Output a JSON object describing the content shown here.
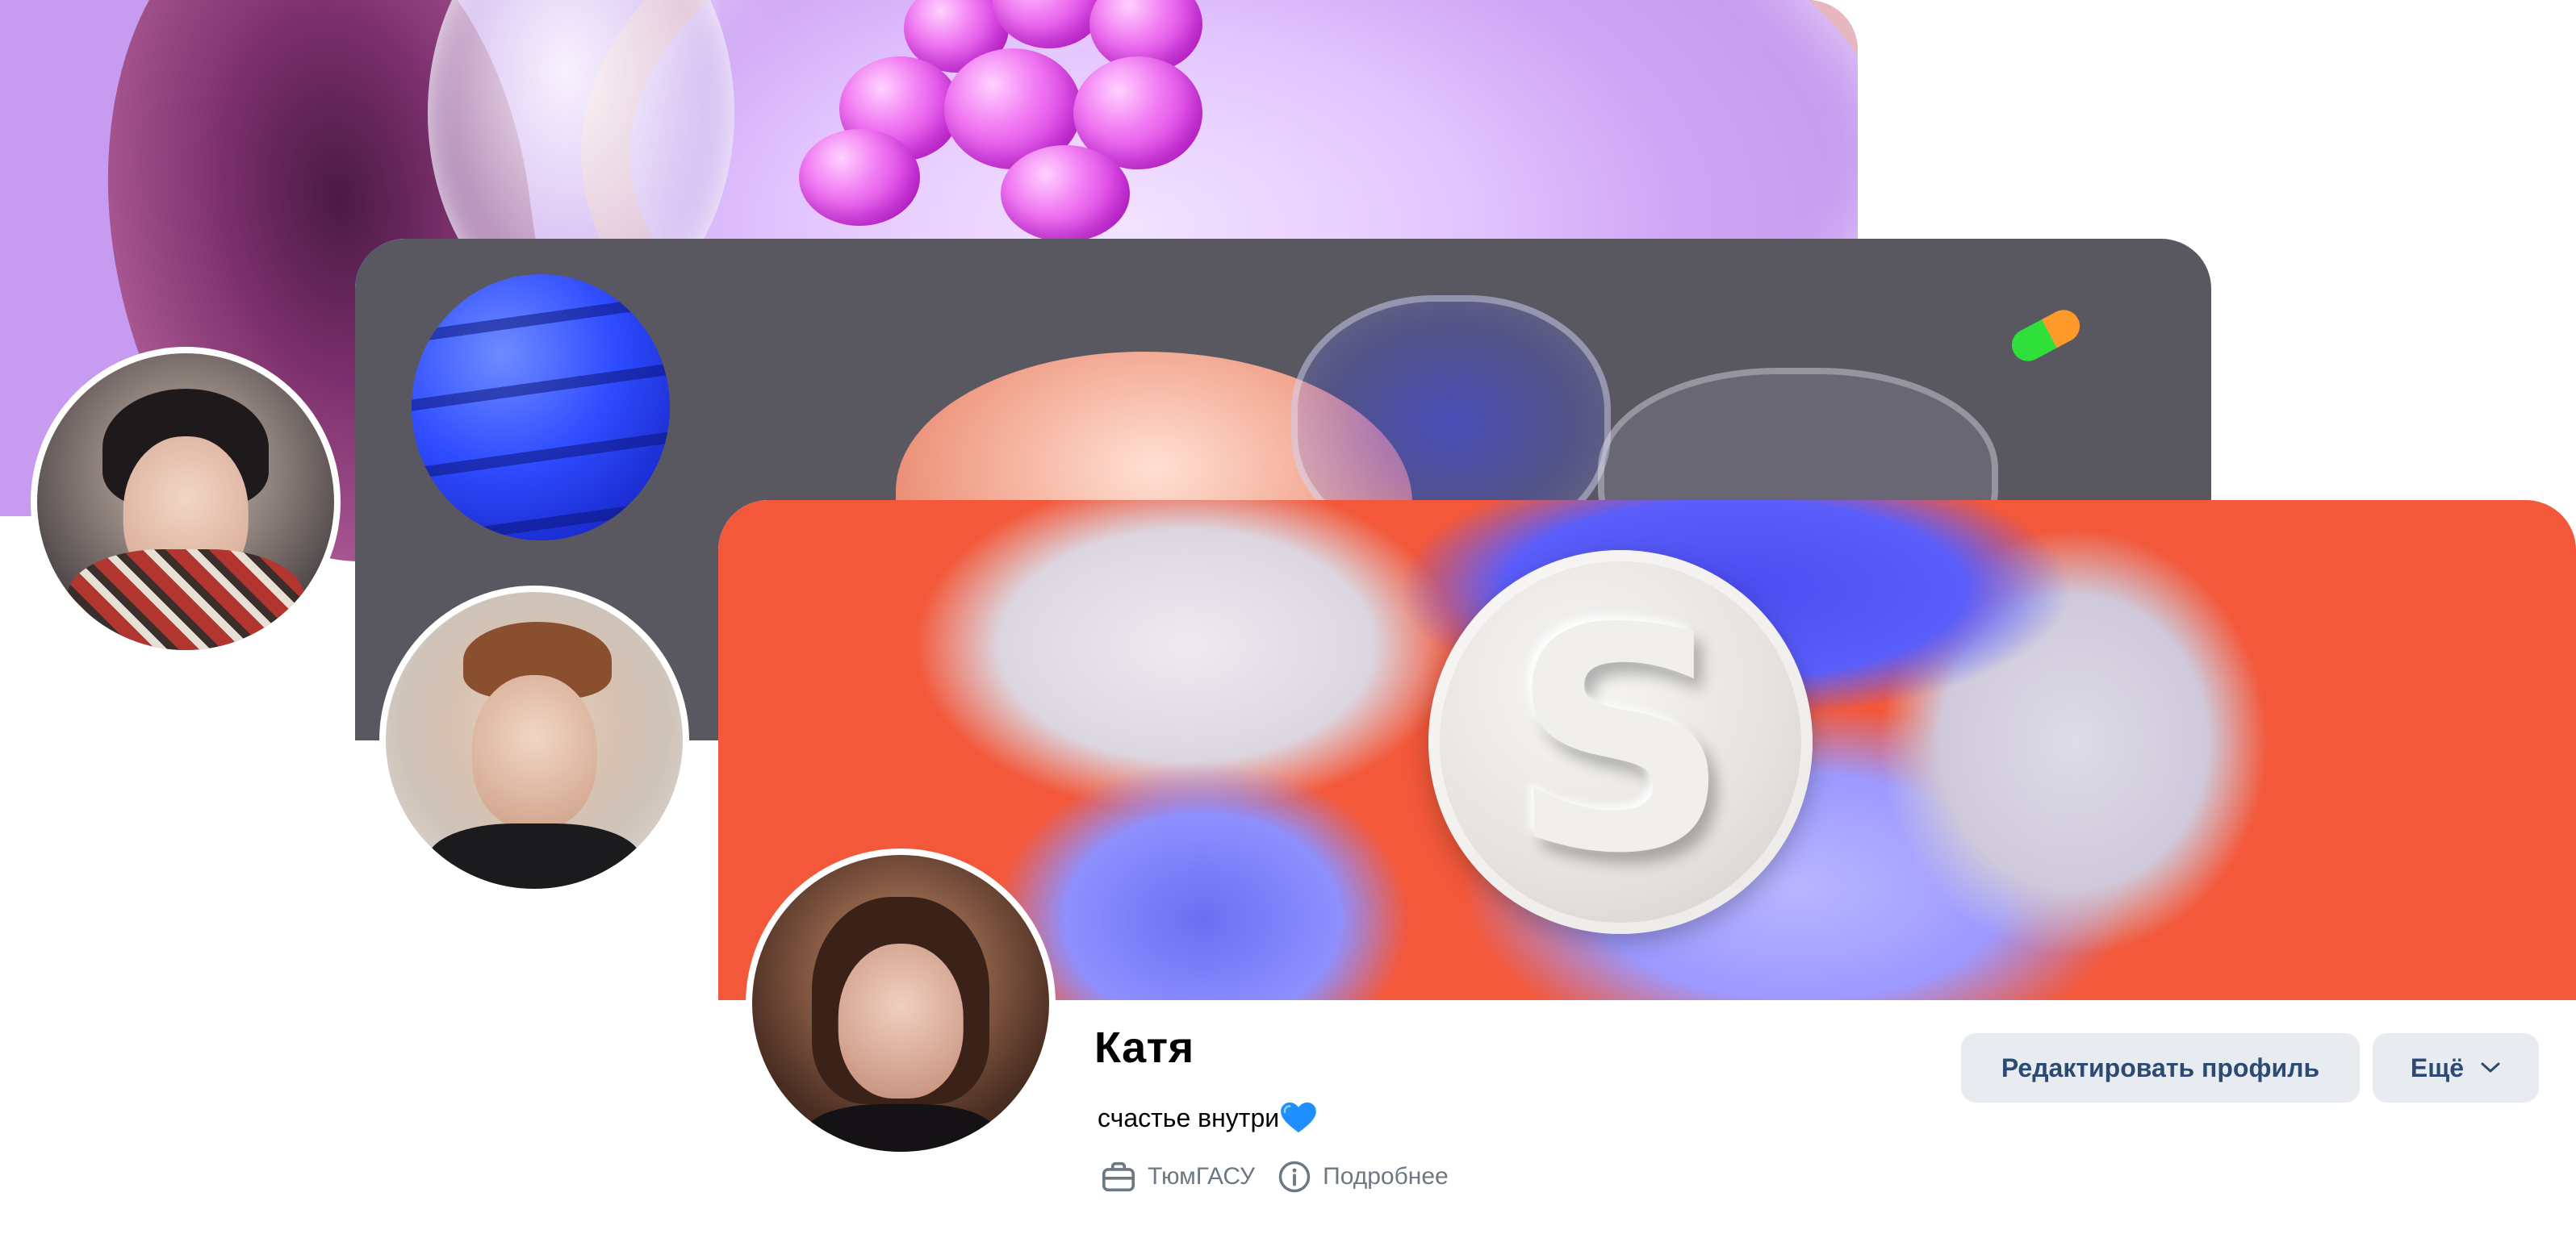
{
  "profiles": [
    {
      "id": "back",
      "cover_theme": "purple"
    },
    {
      "id": "middle",
      "cover_theme": "dark-grey"
    },
    {
      "id": "front",
      "cover_theme": "orange"
    }
  ],
  "front_profile": {
    "name": "Катя",
    "status": "счастье внутри",
    "status_emoji": "blue-heart-icon",
    "workplace": "ТюмГАСУ",
    "details_label": "Подробнее",
    "cover_logo_letter": "S"
  },
  "actions": {
    "edit_label": "Редактировать профиль",
    "more_label": "Ещё"
  },
  "colors": {
    "button_bg": "#e8ecf1",
    "button_text": "#2d4a73",
    "meta_text": "#6d7885",
    "heart": "#1f8fff",
    "front_cover": "#f3583a",
    "middle_cover": "#595760",
    "back_cover": "#cfa6f5"
  }
}
